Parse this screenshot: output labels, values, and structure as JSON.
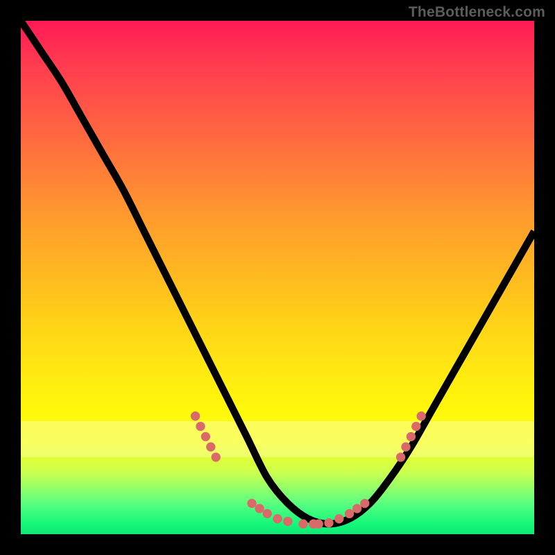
{
  "attribution": "TheBottleneck.com",
  "colors": {
    "frame_bg": "#000000",
    "dot": "#da6a6a",
    "curve": "#000000",
    "gradient_top": "#ff1a55",
    "gradient_bottom": "#10e874"
  },
  "chart_data": {
    "type": "line",
    "title": "",
    "xlabel": "",
    "ylabel": "",
    "xlim": [
      0,
      100
    ],
    "ylim": [
      0,
      100
    ],
    "grid": false,
    "annotations": [
      "TheBottleneck.com"
    ],
    "series": [
      {
        "name": "bottleneck-curve",
        "x": [
          0,
          4,
          8,
          12,
          16,
          20,
          24,
          28,
          32,
          36,
          40,
          44,
          48,
          52,
          56,
          60,
          64,
          68,
          72,
          76,
          80,
          84,
          88,
          92,
          96,
          100
        ],
        "y": [
          100,
          94,
          88,
          81,
          74,
          67,
          59,
          51,
          43,
          35,
          27,
          19,
          11,
          6,
          3,
          2,
          3,
          6,
          11,
          17,
          24,
          31,
          38,
          45,
          52,
          59
        ]
      }
    ],
    "highlight_points": [
      {
        "x": 34,
        "y": 23
      },
      {
        "x": 35,
        "y": 21
      },
      {
        "x": 36,
        "y": 19
      },
      {
        "x": 37,
        "y": 17
      },
      {
        "x": 38,
        "y": 15
      },
      {
        "x": 45,
        "y": 6
      },
      {
        "x": 46.5,
        "y": 5
      },
      {
        "x": 48,
        "y": 4
      },
      {
        "x": 50,
        "y": 3
      },
      {
        "x": 52,
        "y": 2.5
      },
      {
        "x": 55,
        "y": 2
      },
      {
        "x": 57,
        "y": 2
      },
      {
        "x": 58,
        "y": 2
      },
      {
        "x": 60,
        "y": 2.2
      },
      {
        "x": 62,
        "y": 3
      },
      {
        "x": 64,
        "y": 4
      },
      {
        "x": 65.5,
        "y": 5
      },
      {
        "x": 67,
        "y": 6
      },
      {
        "x": 74,
        "y": 15
      },
      {
        "x": 75,
        "y": 17
      },
      {
        "x": 76,
        "y": 19
      },
      {
        "x": 77,
        "y": 21
      },
      {
        "x": 78,
        "y": 23
      }
    ]
  }
}
